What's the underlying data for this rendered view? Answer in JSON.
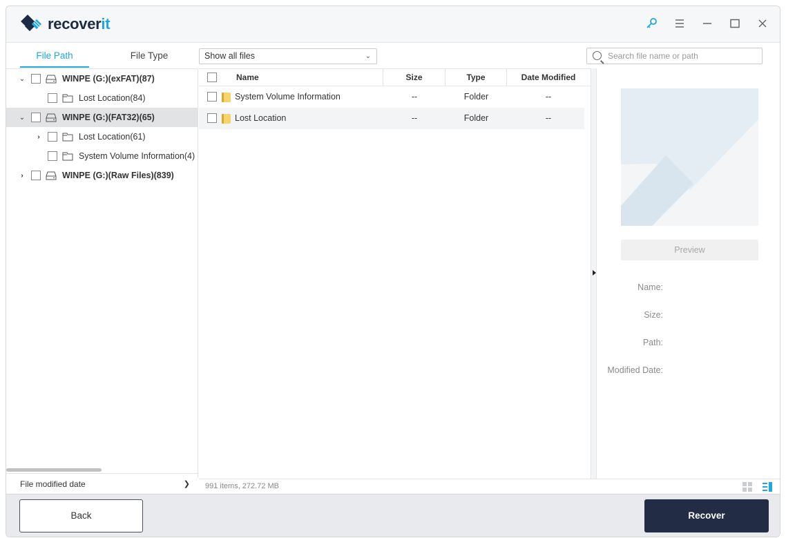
{
  "app": {
    "logo_main": "recover",
    "logo_accent": "it",
    "accent_color": "#1ea7e0",
    "brand_dark": "#232c45"
  },
  "titlebar": {
    "icons": [
      "key-icon",
      "menu-icon",
      "minimize-icon",
      "maximize-icon",
      "close-icon"
    ]
  },
  "tabs": [
    {
      "label": "File Path",
      "active": true
    },
    {
      "label": "File Type",
      "active": false
    }
  ],
  "filter": {
    "selected": "Show all files"
  },
  "search": {
    "placeholder": "Search file name or path"
  },
  "tree": {
    "items": [
      {
        "label": "WINPE (G:)(exFAT)(87)",
        "level": 0,
        "expanded": true,
        "type": "drive"
      },
      {
        "label": "Lost Location(84)",
        "level": 1,
        "type": "folder"
      },
      {
        "label": "WINPE (G:)(FAT32)(65)",
        "level": 0,
        "expanded": true,
        "selected": true,
        "type": "drive"
      },
      {
        "label": "Lost Location(61)",
        "level": 1,
        "collapsed": true,
        "type": "folder"
      },
      {
        "label": "System Volume Information(4)",
        "level": 1,
        "type": "folder"
      },
      {
        "label": "WINPE (G:)(Raw Files)(839)",
        "level": 0,
        "collapsed": true,
        "type": "drive"
      }
    ],
    "footer": "File modified date"
  },
  "list": {
    "columns": [
      "Name",
      "Size",
      "Type",
      "Date Modified"
    ],
    "rows": [
      {
        "name": "System Volume Information",
        "size": "--",
        "type": "Folder",
        "date": "--"
      },
      {
        "name": "Lost Location",
        "size": "--",
        "type": "Folder",
        "date": "--"
      }
    ]
  },
  "preview": {
    "button": "Preview",
    "fields": [
      "Name:",
      "Size:",
      "Path:",
      "Modified Date:"
    ]
  },
  "status": {
    "summary": "991 items, 272.72  MB"
  },
  "actions": {
    "back": "Back",
    "recover": "Recover"
  }
}
